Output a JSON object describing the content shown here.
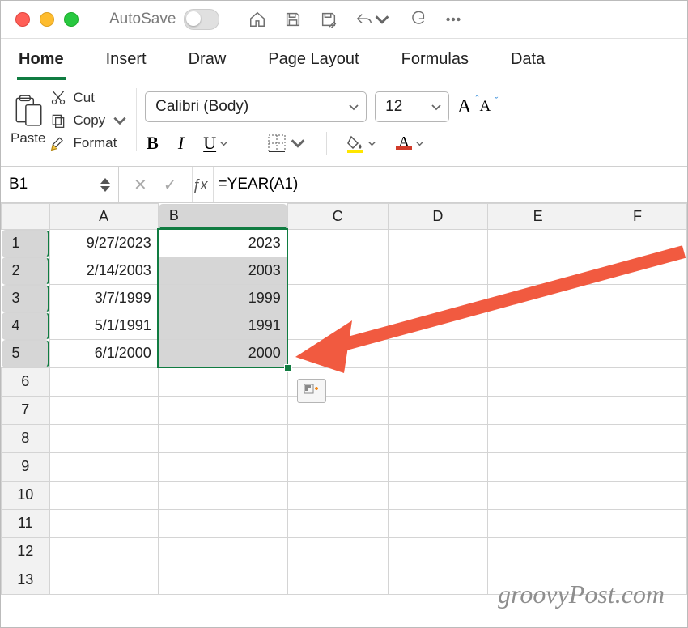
{
  "titlebar": {
    "autosave_label": "AutoSave"
  },
  "tabs": [
    "Home",
    "Insert",
    "Draw",
    "Page Layout",
    "Formulas",
    "Data"
  ],
  "active_tab": "Home",
  "clipboard": {
    "paste": "Paste",
    "cut": "Cut",
    "copy": "Copy",
    "format": "Format"
  },
  "font": {
    "name": "Calibri (Body)",
    "size": "12",
    "bold": "B",
    "italic": "I",
    "underline": "U",
    "grow": "A",
    "shrink": "A",
    "textcolor_letter": "A",
    "fill_color": "#ffe600",
    "text_color": "#d13b2a"
  },
  "formula_bar": {
    "namebox": "B1",
    "formula": "=YEAR(A1)"
  },
  "columns": [
    "A",
    "B",
    "C",
    "D",
    "E",
    "F"
  ],
  "rows": [
    "1",
    "2",
    "3",
    "4",
    "5",
    "6",
    "7",
    "8",
    "9",
    "10",
    "11",
    "12",
    "13"
  ],
  "cells": {
    "A1": "9/27/2023",
    "B1": "2023",
    "A2": "2/14/2003",
    "B2": "2003",
    "A3": "3/7/1999",
    "B3": "1999",
    "A4": "5/1/1991",
    "B4": "1991",
    "A5": "6/1/2000",
    "B5": "2000"
  },
  "selection": {
    "col": "B",
    "rows": [
      1,
      5
    ],
    "active": "B1"
  },
  "watermark": "groovyPost.com"
}
